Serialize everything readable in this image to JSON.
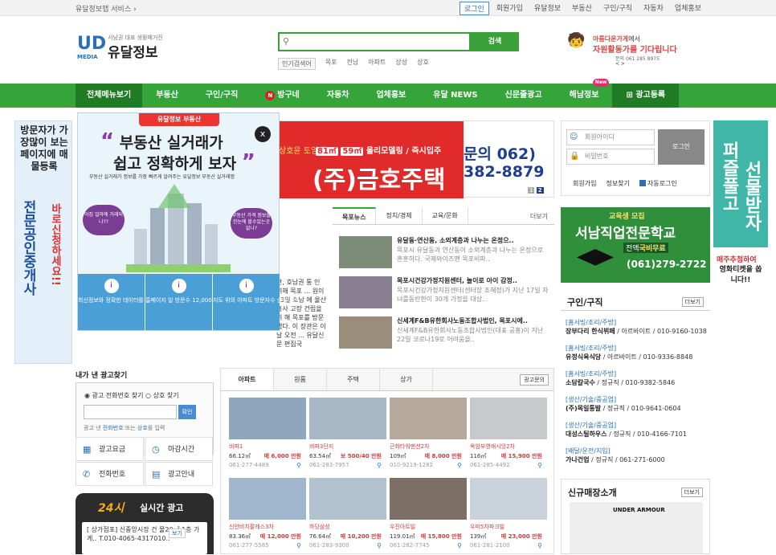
{
  "topbar": {
    "service": "유달정보맵 서비스",
    "links": [
      "로그인",
      "회원가입",
      "유달정보",
      "부동산",
      "구인/구직",
      "자동차",
      "업체홍보"
    ]
  },
  "logo": {
    "mark": "UD",
    "media": "MEDIA",
    "tagline": "서남권 대표 생활매거진",
    "name": "유달정보"
  },
  "search": {
    "placeholder": "",
    "button": "검색",
    "popular_label": "인기검색어",
    "popular": [
      "목포",
      "전남",
      "아파트",
      "상성",
      "상호"
    ]
  },
  "header_banner": {
    "line1_a": "아름다운",
    "line1_b": "가게",
    "line1_c": "에서",
    "line2": "자원활동가를 기다립니다",
    "line3": "문의 061 285 8975",
    "line4": "< >"
  },
  "nav": {
    "all_menu": "전체메뉴보기",
    "items": [
      "부동산",
      "구인/구직",
      "방구네",
      "자동차",
      "업체홍보",
      "유달 NEWS",
      "신문줄광고",
      "해남정보",
      "광고등록"
    ],
    "badge": "N",
    "new": "New"
  },
  "left_ad": {
    "t1": "방문자가 가장많이 보는 페이지에 매물등록",
    "t2": "전문공인중개사",
    "t3": "바로신청하세요!!"
  },
  "popup": {
    "header": "유달정보 부동산",
    "title1": "부동산 실거래가",
    "title2": "쉽고 정확하게 보자",
    "sub": "부동산 실거래가 정보를 가장 빠르게 알려주는 유달정보 부동산 실거래앱",
    "bubble1": "이집 얼마에 거래되나??",
    "bubble2": "부동산 가격 정보를 한눈에 불수있는곳 없나?",
    "close": "x",
    "features": [
      {
        "icon": "i",
        "text": "최신정보와 정확한 데이터를 갖춘 아파트 실거래가 앱"
      },
      {
        "icon": "i",
        "text": "홈페이지 일 방문수 12,000명"
      },
      {
        "icon": "i",
        "text": "지도 위의 아파트 방문자수 순위 제공"
      }
    ]
  },
  "mid_banner": {
    "ad3": "상호윤 토임대",
    "ad1_a": "81㎡",
    "ad1_b": "59㎡",
    "ad1_c": "올리모델링 / 즉시입주",
    "company": "(주)금호주택",
    "phone": "문의 062) 382-8879",
    "page1": "1",
    "page2": "2"
  },
  "newsleft": "관, 호남권 통 인 위해 목포 ... 원이 23일 호남 에 울산 홍사 고장 건립을 위 해 목포를 방문했다. 이 장관은 이날 오전 ... 유달신문 편집국",
  "news": {
    "tabs": [
      "목포뉴스",
      "정치/경제",
      "교육/문화"
    ],
    "more": "더보기",
    "items": [
      {
        "head": "유달동·연산동, 소외계층과 나누는 온정으..",
        "desc": "목포시 유달동과 연산동이 소외계층과 나누는 온정으로 훈훈하다. 국제와이즈맨 목포비파.."
      },
      {
        "head": "목포시건강가정지원센터, 놀이로 아이 감정..",
        "desc": "목포시건강가정지원센터(센터장 조혜정)가 지난 17일 자녀를동반한이 30개 가정을 대상.."
      },
      {
        "head": "신세계F&B유한회사노동조합사법인, 목포시에..",
        "desc": "신세계F&B유한회사노동조합사법인(대표 공홍)이 지난 22일 코로나19로 어려움을.."
      }
    ]
  },
  "adsearch": {
    "title": "내가 낸 광고찾기",
    "opt1": "광고 전화번호 찾기",
    "opt2": "상호 찾기",
    "confirm": "확인",
    "hint_a": "광고 낸 ",
    "hint_b": "전화번호",
    "hint_c": " 또는 ",
    "hint_d": "상호",
    "hint_e": "를 입력",
    "buttons": [
      "광고요금",
      "마감시간",
      "전화번호",
      "광고안내"
    ]
  },
  "realtime": {
    "title": "24시",
    "title2": "실시간 광고",
    "text": "[ 상가점포] 신중앙시장 건 물20㎡ 1층 가게.. T.010-4065-4317010..",
    "more": "보기"
  },
  "property": {
    "tabs": [
      "아파트",
      "원룸",
      "주택",
      "상가"
    ],
    "inquiry": "광고문의",
    "cards": [
      {
        "name": "비파1",
        "size": "66.12㎡",
        "price": "매 6,000 만원",
        "phone": "061-277-4489",
        "color": "#8fa7bd"
      },
      {
        "name": "비파3단지",
        "size": "63.54㎡",
        "price": "보 500/40 만원",
        "phone": "061-283-7957",
        "color": "#a7b7c6"
      },
      {
        "name": "근화타워맨션2차",
        "size": "109㎡",
        "price": "매 8,000 만원",
        "phone": "010-9219-1282",
        "color": "#b6a89a"
      },
      {
        "name": "옥암부영애시앙2차",
        "size": "116㎡",
        "price": "매 15,900 만원",
        "phone": "061-285-4492",
        "color": "#c7c9cc"
      },
      {
        "name": "신안비치팔레스3차",
        "size": "83.36㎡",
        "price": "매 12,000 만원",
        "phone": "061-277-5585",
        "color": "#9fb6cc"
      },
      {
        "name": "하당삼성",
        "size": "76.64㎡",
        "price": "매 10,200 만원",
        "phone": "061-283-9300",
        "color": "#b3c2cf"
      },
      {
        "name": "우진아트빌",
        "size": "119.01㎡",
        "price": "매 15,800 만원",
        "phone": "061-282-7745",
        "color": "#7c6f66"
      },
      {
        "name": "우미5차파크빌",
        "size": "139㎡",
        "price": "매 23,000 만원",
        "phone": "061-281-2100",
        "color": "#c9d2da"
      }
    ]
  },
  "login": {
    "id": "회원아이디",
    "pw": "비밀번호",
    "button": "로그인",
    "join": "회원가입",
    "find": "정보찾기",
    "auto": "자동로그인"
  },
  "school": {
    "recruit": "교육생 모집",
    "name": "서남직업전문학교",
    "free_a": "전액",
    "free_b": "국비무료",
    "phone": "(061)279-2722"
  },
  "jobs": {
    "title": "구인/구직",
    "more": "더보기",
    "items": [
      {
        "cat": "[홈서빙/조리/주방]",
        "co": "장부다리 한식뷔페",
        "rest": " / 아르바이트 / 010-9160-1038"
      },
      {
        "cat": "[홈서빙/조리/주방]",
        "co": "유정식육식당",
        "rest": " / 아르바이트 / 010-9336-8848"
      },
      {
        "cat": "[홈서빙/조리/주방]",
        "co": "소담칼국수",
        "rest": " / 정규직 / 010-9382-5846"
      },
      {
        "cat": "[생산/기술/중공업]",
        "co": "(주)목일통발",
        "rest": " / 정규직 / 010-9641-0604"
      },
      {
        "cat": "[생산/기술/중공업]",
        "co": "대성스틸하우스",
        "rest": " / 정규직 / 010-4166-7101"
      },
      {
        "cat": "[배달/운전/지입]",
        "co": "가나건업",
        "rest": " / 정규직 / 061-271-6000"
      }
    ]
  },
  "newstore": {
    "title": "신규매장소개",
    "more": "더보기",
    "brand": "UNDER ARMOUR"
  },
  "right_ad": {
    "v1": "퍼즐풀고",
    "v2": "선물받자",
    "l1": "매주추첨하여",
    "l2": "영화티켓을 쏩니다!!"
  }
}
